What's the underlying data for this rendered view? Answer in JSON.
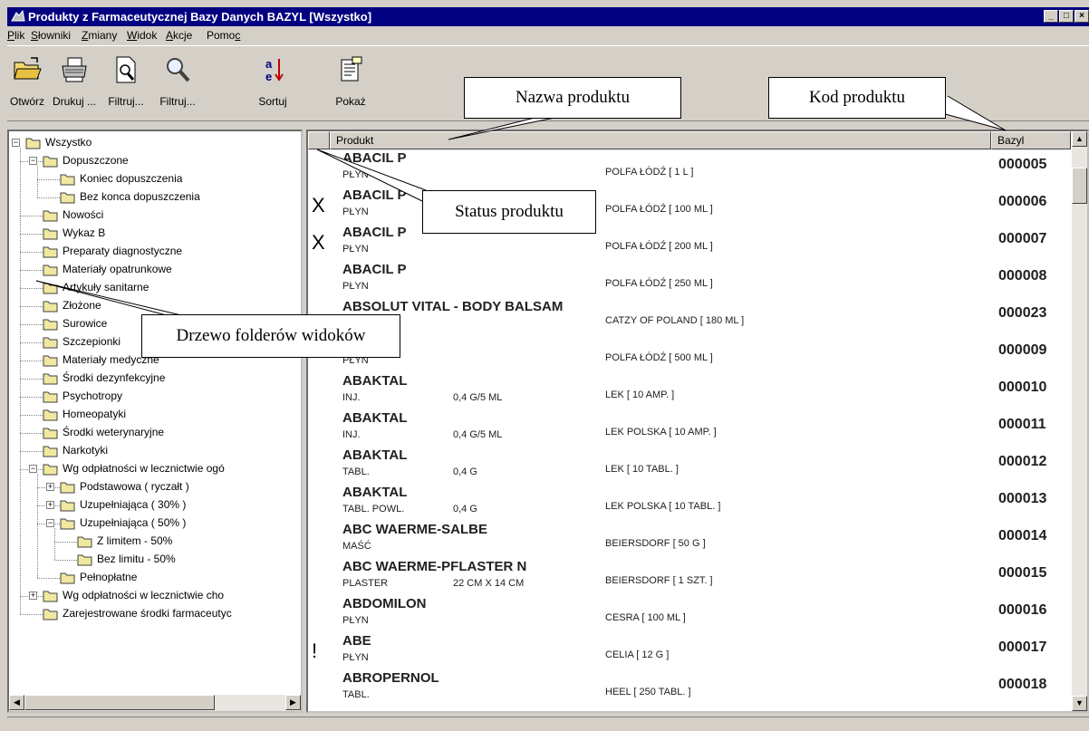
{
  "window": {
    "title": "Produkty z Farmaceutycznej Bazy Danych BAZYL [Wszystko]"
  },
  "menu": [
    {
      "prefix": "",
      "key": "P",
      "rest": "lik"
    },
    {
      "prefix": "",
      "key": "S",
      "rest": "łowniki"
    },
    {
      "prefix": "",
      "key": "Z",
      "rest": "miany"
    },
    {
      "prefix": "",
      "key": "W",
      "rest": "idok"
    },
    {
      "prefix": "",
      "key": "A",
      "rest": "kcje"
    },
    {
      "prefix": "Pomo",
      "key": "c",
      "rest": ""
    }
  ],
  "toolbar": {
    "open_label": "Otwórz",
    "print_label": "Drukuj ...",
    "filter1_label": "Filtruj...",
    "filter2_label": "Filtruj...",
    "sort_label": "Sortuj",
    "show_label": "Pokaż"
  },
  "tree": [
    "Wszystko",
    "Dopuszczone",
    "Koniec dopuszczenia",
    "Bez konca dopuszczenia",
    "Nowości",
    "Wykaz B",
    "Preparaty diagnostyczne",
    "Materiały opatrunkowe",
    "Artykuły sanitarne",
    "Złożone",
    "Surowice",
    "Szczepionki",
    "Materiały medyczne",
    "Środki dezynfekcyjne",
    "Psychotropy",
    "Homeopatyki",
    "Środki weterynaryjne",
    "Narkotyki",
    "Wg odpłatności w lecznictwie ogó",
    "Podstawowa ( ryczałt )",
    "Uzupełniająca ( 30% )",
    "Uzupełniająca ( 50% )",
    "Z limitem - 50%",
    "Bez limitu - 50%",
    "Pełnopłatne",
    "Wg odpłatności w lecznictwie cho",
    "Zarejestrowane środki farmaceutyc"
  ],
  "list": {
    "col_product": "Produkt",
    "col_code": "Bazyl",
    "rows": [
      {
        "status": "",
        "name": "ABACIL P",
        "form": "PŁYN",
        "dose": "",
        "maker": "POLFA ŁÓDŹ [ 1 L ]",
        "code": "000005"
      },
      {
        "status": "X",
        "name": "ABACIL P",
        "form": "PŁYN",
        "dose": "",
        "maker": "POLFA ŁÓDŹ [ 100 ML ]",
        "code": "000006"
      },
      {
        "status": "X",
        "name": "ABACIL P",
        "form": "PŁYN",
        "dose": "",
        "maker": "POLFA ŁÓDŹ [ 200 ML ]",
        "code": "000007"
      },
      {
        "status": "",
        "name": "ABACIL P",
        "form": "PŁYN",
        "dose": "",
        "maker": "POLFA ŁÓDŹ [ 250 ML ]",
        "code": "000008"
      },
      {
        "status": "",
        "name": "ABSOLUT VITAL - BODY BALSAM",
        "form": "",
        "dose": "",
        "maker": "CATZY OF POLAND [ 180 ML ]",
        "code": "000023"
      },
      {
        "status": "",
        "name": "",
        "form": "PŁYN",
        "dose": "",
        "maker": "POLFA ŁÓDŹ [ 500 ML ]",
        "code": "000009"
      },
      {
        "status": "",
        "name": "ABAKTAL",
        "form": "INJ.",
        "dose": "0,4 G/5 ML",
        "maker": "LEK [ 10 AMP. ]",
        "code": "000010"
      },
      {
        "status": "",
        "name": "ABAKTAL",
        "form": "INJ.",
        "dose": "0,4 G/5 ML",
        "maker": "LEK POLSKA [ 10 AMP. ]",
        "code": "000011"
      },
      {
        "status": "",
        "name": "ABAKTAL",
        "form": "TABL.",
        "dose": "0,4 G",
        "maker": "LEK [ 10 TABL. ]",
        "code": "000012"
      },
      {
        "status": "",
        "name": "ABAKTAL",
        "form": "TABL. POWL.",
        "dose": "0,4 G",
        "maker": "LEK POLSKA [ 10 TABL. ]",
        "code": "000013"
      },
      {
        "status": "",
        "name": "ABC WAERME-SALBE",
        "form": "MAŚĆ",
        "dose": "",
        "maker": "BEIERSDORF [ 50 G ]",
        "code": "000014"
      },
      {
        "status": "",
        "name": "ABC WAERME-PFLASTER N",
        "form": "PLASTER",
        "dose": "22 CM X 14 CM",
        "maker": "BEIERSDORF [ 1 SZT. ]",
        "code": "000015"
      },
      {
        "status": "",
        "name": "ABDOMILON",
        "form": "PŁYN",
        "dose": "",
        "maker": "CESRA [ 100 ML ]",
        "code": "000016"
      },
      {
        "status": "!",
        "name": "ABE",
        "form": "PŁYN",
        "dose": "",
        "maker": "CELIA [ 12 G ]",
        "code": "000017"
      },
      {
        "status": "",
        "name": "ABROPERNOL",
        "form": "TABL.",
        "dose": "",
        "maker": "HEEL [ 250 TABL. ]",
        "code": "000018"
      }
    ]
  },
  "callouts": {
    "name": "Nazwa produktu",
    "code": "Kod produktu",
    "status": "Status produktu",
    "tree": "Drzewo folderów widoków"
  },
  "colors": {
    "titlebar": "#000080",
    "face": "#d4d0c8",
    "folder": "#f0e8a0"
  }
}
